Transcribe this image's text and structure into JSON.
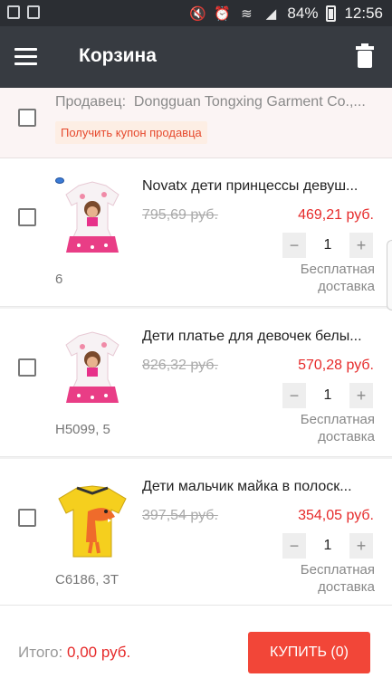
{
  "status_bar": {
    "battery": "84%",
    "time": "12:56"
  },
  "toolbar": {
    "title": "Корзина"
  },
  "seller": {
    "label": "Продавец:",
    "name": "Dongguan Tongxing Garment Co.,...",
    "coupon_label": "Получить купон продавца"
  },
  "items": [
    {
      "title": "Novatx дети принцессы девуш...",
      "old_price": "795,69 руб.",
      "new_price": "469,21 руб.",
      "quantity": "1",
      "variant": "6",
      "shipping_line1": "Бесплатная",
      "shipping_line2": "доставка",
      "image": "pink-girl-dress"
    },
    {
      "title": "Дети платье для девочек белы...",
      "old_price": "826,32 руб.",
      "new_price": "570,28 руб.",
      "quantity": "1",
      "variant": "H5099, 5",
      "shipping_line1": "Бесплатная",
      "shipping_line2": "доставка",
      "image": "pink-girl-dress"
    },
    {
      "title": "Дети мальчик майка в полоск...",
      "old_price": "397,54 руб.",
      "new_price": "354,05 руб.",
      "quantity": "1",
      "variant": "C6186, 3T",
      "shipping_line1": "Бесплатная",
      "shipping_line2": "доставка",
      "image": "yellow-dino-tshirt"
    }
  ],
  "stepper": {
    "minus": "−",
    "plus": "+"
  },
  "footer": {
    "total_label": "Итого:",
    "total_value": "0,00 руб.",
    "buy_label": "КУПИТЬ (0)"
  },
  "colors": {
    "accent": "#f24638",
    "price": "#e62a2a",
    "toolbar": "#373b41"
  }
}
